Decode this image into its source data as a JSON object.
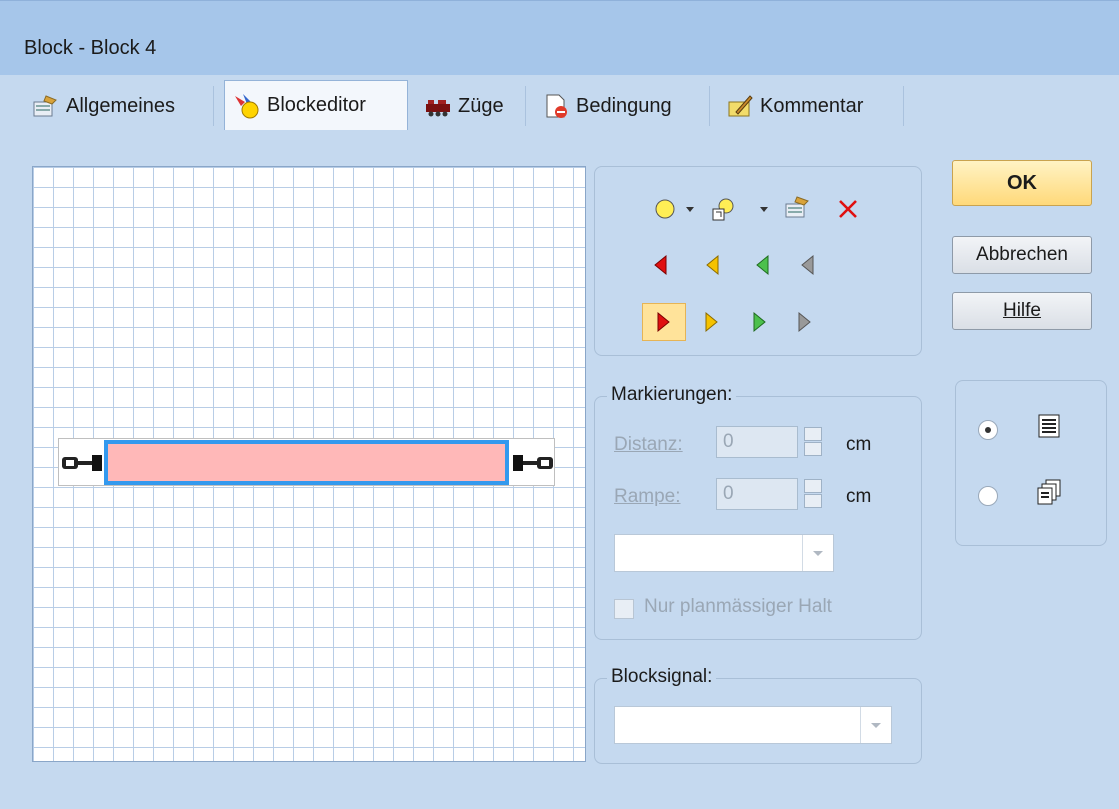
{
  "window": {
    "title": "Block - Block 4"
  },
  "tabs": [
    {
      "label": "Allgemeines",
      "icon": "settings-icon"
    },
    {
      "label": "Blockeditor",
      "icon": "block-editor-icon"
    },
    {
      "label": "Züge",
      "icon": "train-icon"
    },
    {
      "label": "Bedingung",
      "icon": "condition-icon"
    },
    {
      "label": "Kommentar",
      "icon": "comment-icon"
    }
  ],
  "active_tab": "Blockeditor",
  "toolbar": {
    "row1": [
      "circle-marker-icon",
      "dropdown-arrow-icon",
      "shape-marker-icon",
      "dropdown-arrow-icon",
      "properties-icon",
      "delete-icon"
    ],
    "left_arrows": [
      "#e01010",
      "#f0b000",
      "#3cb043",
      "#8a8a8a"
    ],
    "right_arrows": [
      "#e01010",
      "#f0b000",
      "#3cb043",
      "#8a8a8a"
    ],
    "selected": "red-right-arrow"
  },
  "markierungen": {
    "legend": "Markierungen:",
    "distanz_label": "Distanz:",
    "distanz_value": "0",
    "distanz_unit": "cm",
    "rampe_label": "Rampe:",
    "rampe_value": "0",
    "rampe_unit": "cm",
    "checkbox_label": "Nur planmässiger Halt"
  },
  "blocksignal": {
    "legend": "Blocksignal:"
  },
  "buttons": {
    "ok": "OK",
    "cancel": "Abbrechen",
    "help": "Hilfe"
  },
  "view_options": {
    "selected": "list-view-icon",
    "options": [
      "list-view-icon",
      "cascade-view-icon"
    ]
  },
  "colors": {
    "block_fill": "#ffb8b8",
    "block_border": "#3399ee",
    "accent_button": "#ffd97a"
  }
}
